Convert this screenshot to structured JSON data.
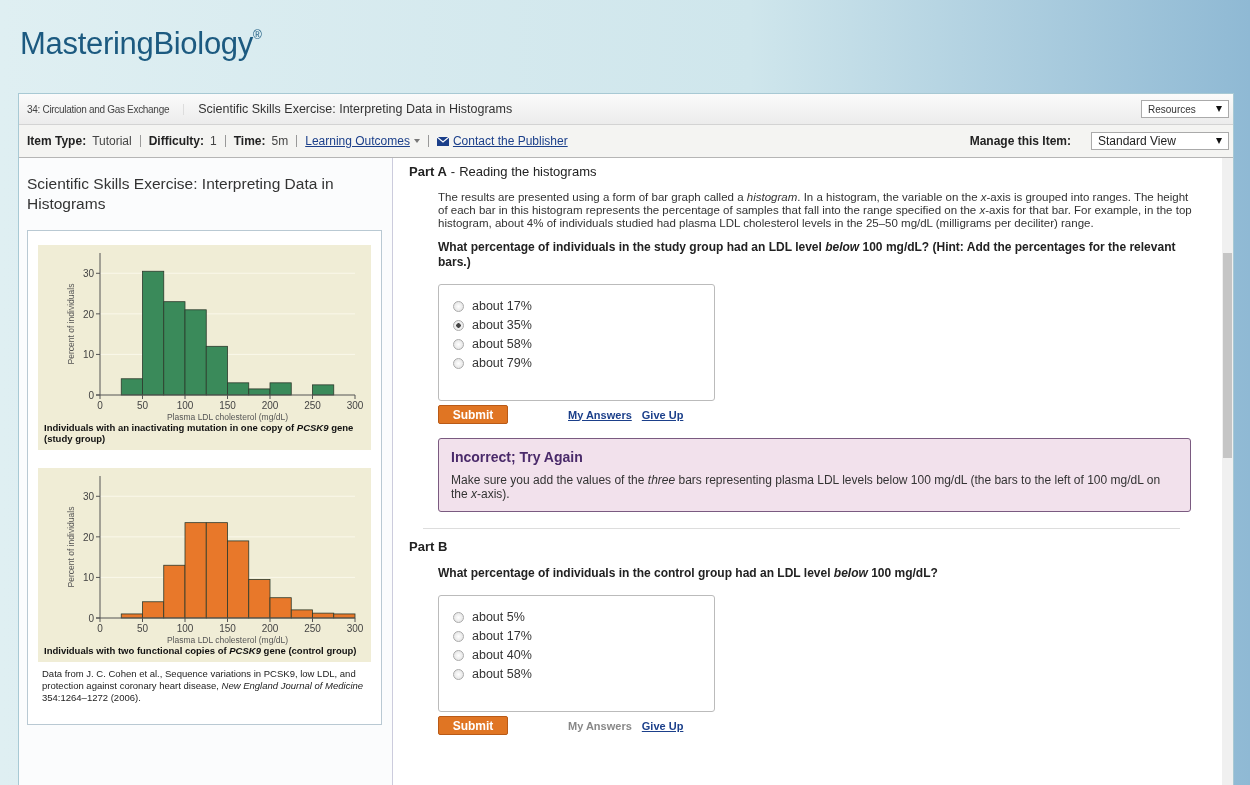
{
  "logo": {
    "text": "MasteringBiology$^{®}$"
  },
  "breadcrumb": [
    {
      "label": "34: Circulation and Gas Exchange",
      "kind": "parent"
    },
    {
      "label": "Scientific Skills Exercise: Interpreting Data in Histograms",
      "kind": "current"
    }
  ],
  "resources_menu": {
    "label": "Resources"
  },
  "item_info": [
    {
      "label": "Item Type:",
      "value": "Tutorial"
    },
    {
      "label": "Difficulty:",
      "value": "1"
    },
    {
      "label": "Time:",
      "value": "5m"
    }
  ],
  "learning_outcomes": {
    "label": "Learning Outcomes"
  },
  "contact_link": {
    "label": "Contact the Publisher"
  },
  "manage": {
    "label": "Manage this Item:",
    "value": "Standard View"
  },
  "sidebar": {
    "title": "Scientific Skills Exercise: Interpreting Data in Histograms",
    "figures": [
      {
        "caption": "Individuals with an inactivating mutation in one copy of *PCSK9* gene (study group)",
        "chart_data": {
          "type": "bar",
          "xlabel": "Plasma LDL cholesterol (mg/dL)",
          "ylabel": "Percent of individuals",
          "x": [
            37.5,
            62.5,
            87.5,
            112.5,
            137.5,
            162.5,
            187.5,
            212.5,
            262.5
          ],
          "series": [
            {
              "color": "#3a8a5a",
              "values": [
                4,
                30.5,
                23,
                21,
                12,
                3,
                1.5,
                3,
                2.5
              ]
            }
          ],
          "xlim": [
            0,
            300
          ],
          "ylim": [
            0,
            35
          ],
          "grid": true,
          "xticks": [
            0,
            50,
            100,
            150,
            200,
            250,
            300
          ],
          "yticks": [
            0,
            10,
            20,
            30
          ]
        }
      },
      {
        "caption": "Individuals with two functional copies of *PCSK9* gene (control group)",
        "chart_data": {
          "type": "bar",
          "xlabel": "Plasma LDL cholesterol (mg/dL)",
          "ylabel": "Percent of individuals",
          "x": [
            37.5,
            62.5,
            87.5,
            112.5,
            137.5,
            162.5,
            187.5,
            212.5,
            237.5,
            262.5,
            287.5
          ],
          "series": [
            {
              "color": "#e8782a",
              "values": [
                1,
                4,
                13,
                23.5,
                23.5,
                19,
                9.5,
                5,
                2,
                1.2,
                1
              ]
            }
          ],
          "xlim": [
            0,
            300
          ],
          "ylim": [
            0,
            35
          ],
          "grid": true,
          "xticks": [
            0,
            50,
            100,
            150,
            200,
            250,
            300
          ],
          "yticks": [
            0,
            10,
            20,
            30
          ]
        }
      }
    ],
    "source": "Data from J. C. Cohen et al., Sequence variations in PCSK9, low LDL, and protection against coronary heart disease, *New England Journal of Medicine* 354:1264–1272 (2006)."
  },
  "parts": [
    {
      "title": "Part A",
      "separator": "-",
      "subtitle": "Reading the histograms",
      "intro": "The results are presented using a form of bar graph called a *histogram*. In a histogram, the variable on the *x*-axis is grouped into ranges. The height of each bar in this histogram represents the percentage of samples that fall into the range specified on the *x*-axis for that bar. For example, in the top histogram, about 4% of individuals studied had plasma LDL cholesterol levels in the 25–50 mg/dL (milligrams per deciliter) range.",
      "question": "What percentage of individuals in the study group had an LDL level *below* 100 mg/dL? (Hint: Add the percentages for the relevant bars.)",
      "choices": [
        {
          "label": "about 17%",
          "selected": false
        },
        {
          "label": "about 35%",
          "selected": true
        },
        {
          "label": "about 58%",
          "selected": false
        },
        {
          "label": "about 79%",
          "selected": false
        }
      ],
      "submit": "Submit",
      "my_answers": {
        "label": "My Answers",
        "disabled": false
      },
      "give_up": "Give Up",
      "feedback": {
        "title": "Incorrect; Try Again",
        "text": "Make sure you add the values of the *three* bars representing plasma LDL levels below 100 mg/dL (the bars to the left of 100 mg/dL on the *x*-axis)."
      }
    },
    {
      "title": "Part B",
      "question": "What percentage of individuals in the control group had an LDL level *below* 100 mg/dL?",
      "choices": [
        {
          "label": "about 5%",
          "selected": false
        },
        {
          "label": "about 17%",
          "selected": false
        },
        {
          "label": "about 40%",
          "selected": false
        },
        {
          "label": "about 58%",
          "selected": false
        }
      ],
      "submit": "Submit",
      "my_answers": {
        "label": "My Answers",
        "disabled": true
      },
      "give_up": "Give Up"
    }
  ]
}
